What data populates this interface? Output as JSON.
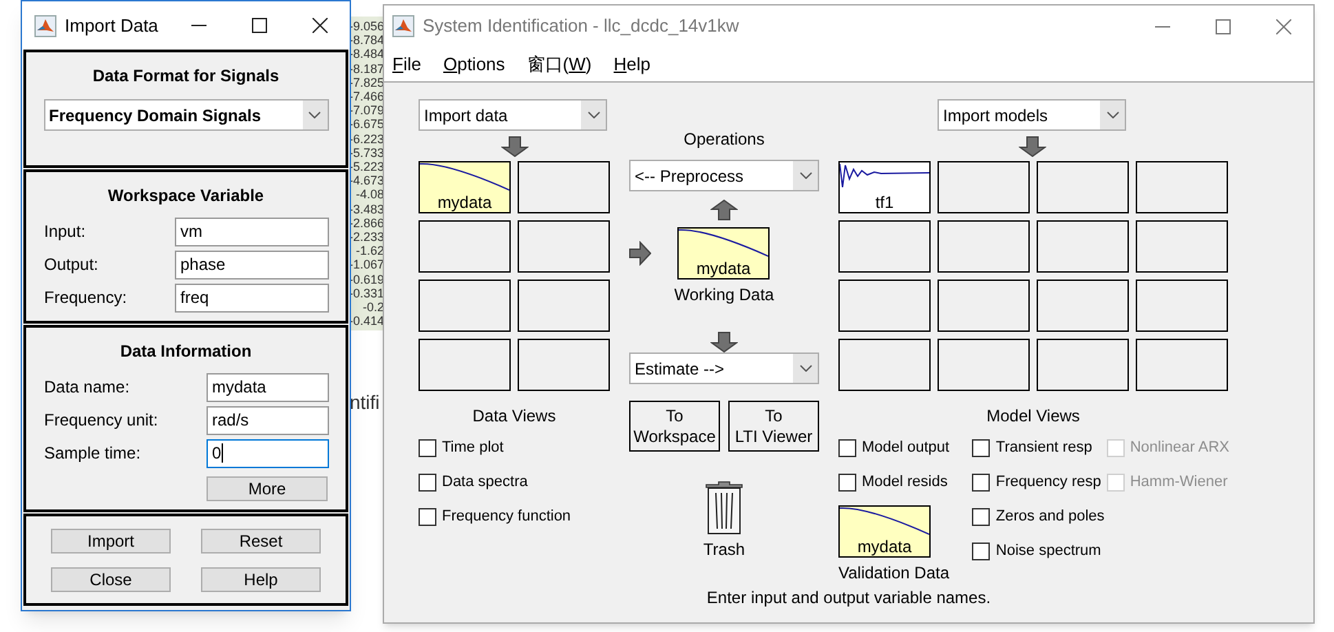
{
  "background": {
    "sheet_values": [
      "-9.056",
      "-8.784",
      "-8.484",
      "-8.187",
      "-7.825",
      "-7.466",
      "-7.079",
      "-6.675",
      "-6.223",
      "-5.733",
      "-5.223",
      "-4.673",
      "-4.08",
      "-3.483",
      "-2.866",
      "-2.233",
      "-1.62",
      "-1.067",
      "-0.619",
      "-0.331",
      "-0.2",
      "-0.414"
    ],
    "partial_text": "ntifi"
  },
  "import_dialog": {
    "title": "Import Data",
    "format_panel": {
      "heading": "Data Format for Signals",
      "selected": "Frequency Domain Signals"
    },
    "workspace_panel": {
      "heading": "Workspace Variable",
      "fields": [
        {
          "label": "Input:",
          "value": "vm",
          "focused": false
        },
        {
          "label": "Output:",
          "value": "phase",
          "focused": false
        },
        {
          "label": "Frequency:",
          "value": "freq",
          "focused": false
        }
      ]
    },
    "info_panel": {
      "heading": "Data Information",
      "fields": [
        {
          "label": "Data name:",
          "value": "mydata",
          "focused": false
        },
        {
          "label": "Frequency unit:",
          "value": "rad/s",
          "focused": false
        },
        {
          "label": "Sample time:",
          "value": "0",
          "focused": true
        }
      ],
      "more_button": "More"
    },
    "buttons": [
      "Import",
      "Reset",
      "Close",
      "Help"
    ]
  },
  "sysid_window": {
    "title": "System Identification - llc_dcdc_14v1kw",
    "menu": [
      {
        "key": "F",
        "post": "ile"
      },
      {
        "key": "O",
        "post": "ptions"
      },
      {
        "pre": "窗口(",
        "key": "W",
        "post": ")"
      },
      {
        "key": "H",
        "post": "elp"
      }
    ],
    "import_data": "Import data",
    "data_boards": [
      {
        "kind": "data",
        "label": "mydata"
      },
      {
        "kind": "empty"
      },
      {
        "kind": "empty"
      },
      {
        "kind": "empty"
      },
      {
        "kind": "empty"
      },
      {
        "kind": "empty"
      },
      {
        "kind": "empty"
      },
      {
        "kind": "empty"
      }
    ],
    "data_views_label": "Data Views",
    "data_views": [
      {
        "label": "Time plot",
        "checked": false,
        "disabled": false
      },
      {
        "label": "Data spectra",
        "checked": false,
        "disabled": false
      },
      {
        "label": "Frequency function",
        "checked": false,
        "disabled": false
      }
    ],
    "operations_label": "Operations",
    "preprocess": "<-- Preprocess",
    "working_data": {
      "kind": "data",
      "label": "mydata"
    },
    "working_data_label": "Working Data",
    "estimate": "Estimate -->",
    "to_workspace": [
      "To",
      "Workspace"
    ],
    "to_lti_viewer": [
      "To",
      "LTI Viewer"
    ],
    "trash_label": "Trash",
    "import_models": "Import models",
    "model_boards": [
      {
        "kind": "model",
        "label": "tf1"
      },
      {
        "kind": "empty"
      },
      {
        "kind": "empty"
      },
      {
        "kind": "empty"
      },
      {
        "kind": "empty"
      },
      {
        "kind": "empty"
      },
      {
        "kind": "empty"
      },
      {
        "kind": "empty"
      },
      {
        "kind": "empty"
      },
      {
        "kind": "empty"
      },
      {
        "kind": "empty"
      },
      {
        "kind": "empty"
      },
      {
        "kind": "empty"
      },
      {
        "kind": "empty"
      },
      {
        "kind": "empty"
      },
      {
        "kind": "empty"
      }
    ],
    "model_views_label": "Model Views",
    "model_views": [
      [
        {
          "label": "Model output",
          "checked": false,
          "disabled": false
        },
        {
          "label": "Model resids",
          "checked": false,
          "disabled": false
        }
      ],
      [
        {
          "label": "Transient resp",
          "checked": false,
          "disabled": false
        },
        {
          "label": "Frequency resp",
          "checked": false,
          "disabled": false
        },
        {
          "label": "Zeros and poles",
          "checked": false,
          "disabled": false
        },
        {
          "label": "Noise spectrum",
          "checked": false,
          "disabled": false
        }
      ],
      [
        {
          "label": "Nonlinear ARX",
          "checked": false,
          "disabled": true
        },
        {
          "label": "Hamm-Wiener",
          "checked": false,
          "disabled": true
        }
      ]
    ],
    "validation_data": {
      "kind": "data",
      "label": "mydata"
    },
    "validation_data_label": "Validation Data",
    "status": "Enter input and output variable names."
  }
}
